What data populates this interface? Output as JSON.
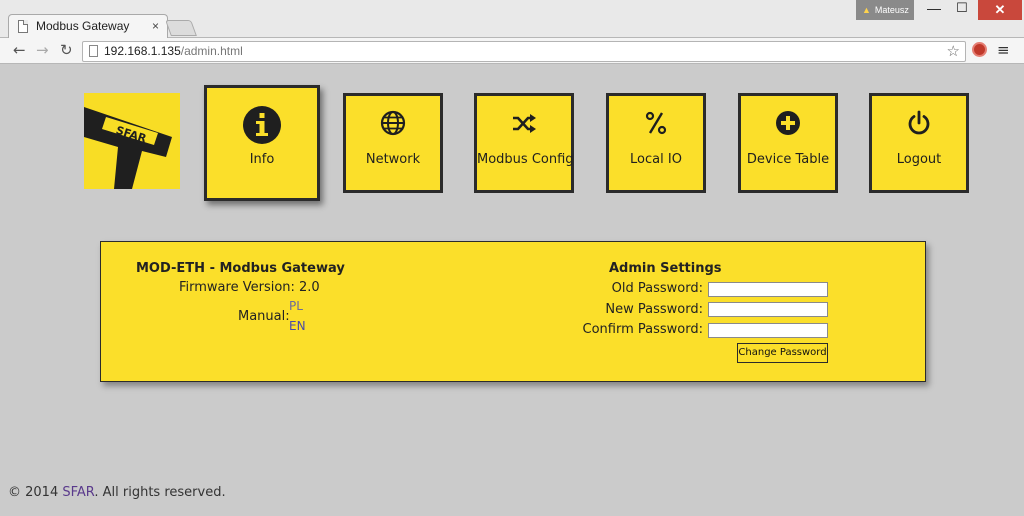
{
  "browser": {
    "tab_title": "Modbus Gateway",
    "tab_close": "×",
    "user_name": "Mateusz",
    "url_host": "192.168.1.135",
    "url_path": "/admin.html"
  },
  "logo_text": "SFAR",
  "nav": {
    "items": [
      {
        "label": "Info",
        "icon": "info-icon",
        "active": true
      },
      {
        "label": "Network",
        "icon": "globe-icon",
        "active": false
      },
      {
        "label": "Modbus Config",
        "icon": "shuffle-icon",
        "active": false
      },
      {
        "label": "Local IO",
        "icon": "percent-icon",
        "active": false
      },
      {
        "label": "Device Table",
        "icon": "plus-circle-icon",
        "active": false
      },
      {
        "label": "Logout",
        "icon": "power-icon",
        "active": false
      }
    ]
  },
  "info": {
    "title": "MOD-ETH - Modbus Gateway",
    "firmware_label": "Firmware Version: 2.0",
    "manual_label": "Manual:",
    "manual_links": [
      "PL",
      "EN"
    ]
  },
  "admin": {
    "title": "Admin Settings",
    "old_password_label": "Old Password:",
    "new_password_label": "New Password:",
    "confirm_password_label": "Confirm Password:",
    "change_button": "Change Password"
  },
  "footer": {
    "prefix": "© 2014 ",
    "company": "SFAR",
    "suffix": ". All rights reserved."
  },
  "colors": {
    "accent_yellow": "#fbdf2a",
    "border_dark": "#2b2b2b",
    "page_bg": "#cbcbcb"
  }
}
